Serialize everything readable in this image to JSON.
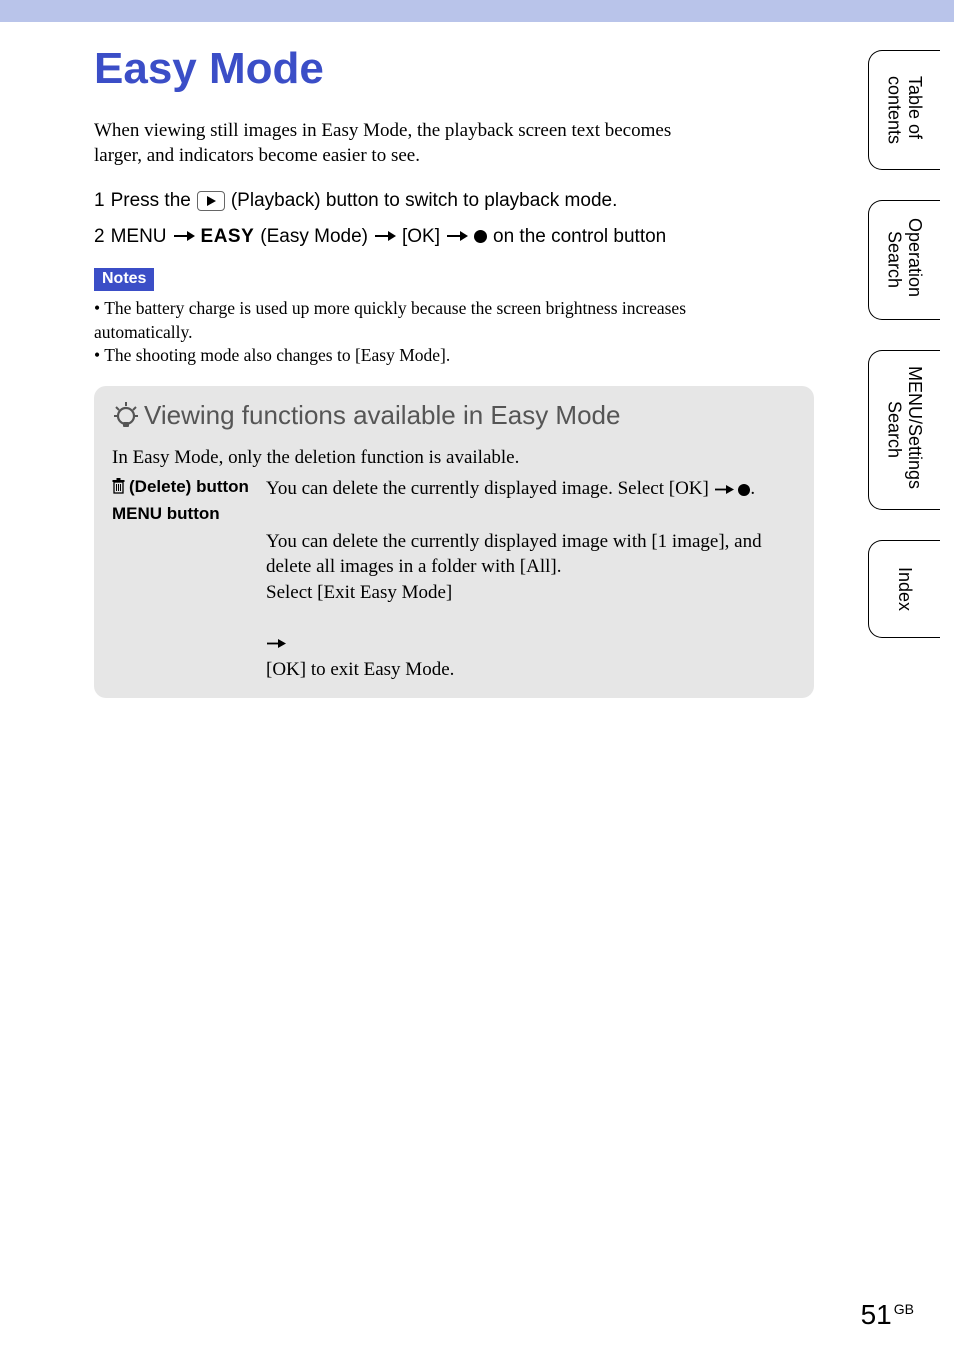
{
  "title": "Easy Mode",
  "intro": "When viewing still images in Easy Mode, the playback screen text becomes larger, and indicators become easier to see.",
  "steps": {
    "s1_num": "1",
    "s1_a": "Press the ",
    "s1_b": " (Playback) button to switch to playback mode.",
    "s2_num": "2",
    "s2_a": "MENU ",
    "s2_easy": "EASY",
    "s2_b": " (Easy Mode) ",
    "s2_c": " [OK] ",
    "s2_d": " on the control button"
  },
  "notes_label": "Notes",
  "notes": [
    "The battery charge is used up more quickly because the screen brightness increases automatically.",
    "The shooting mode also changes to [Easy Mode]."
  ],
  "tip": {
    "title": "Viewing functions available in Easy Mode",
    "intro": "In Easy Mode, only the deletion function is available.",
    "rows": [
      {
        "label": " (Delete) button",
        "desc_a": "You can delete the currently displayed image. Select [OK] ",
        "desc_b": "."
      },
      {
        "label": "MENU button",
        "desc_a": "You can delete the currently displayed image with [1 image], and delete all images in a folder with [All].\nSelect [Exit Easy Mode] ",
        "desc_b": " [OK] to exit Easy Mode."
      }
    ]
  },
  "tabs": {
    "toc": "Table of \ncontents",
    "op": "Operation \nSearch",
    "menu": "MENU/Settings \nSearch",
    "index": "Index"
  },
  "footer": {
    "page": "51",
    "lang": "GB"
  }
}
